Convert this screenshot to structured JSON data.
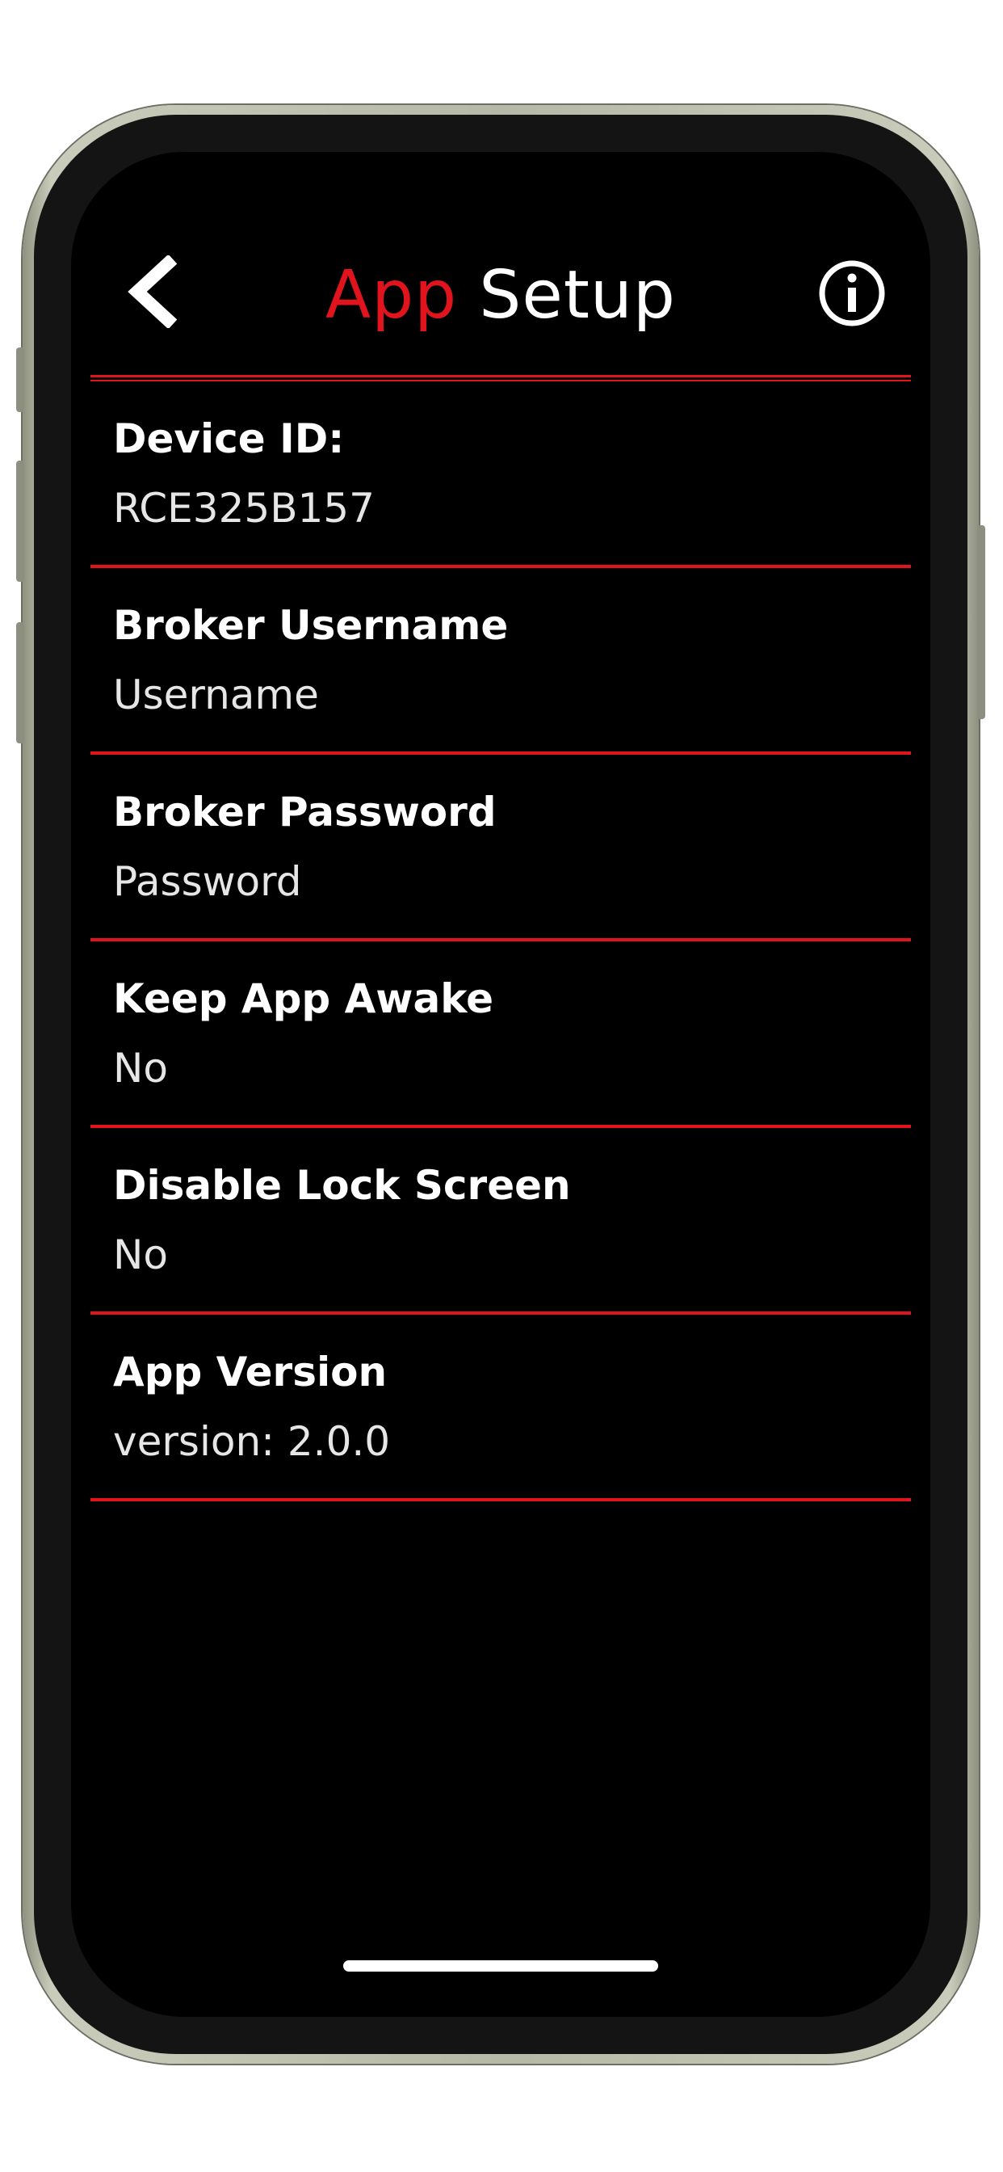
{
  "header": {
    "title_accent": "App",
    "title_rest": " Setup",
    "back_icon": "chevron-left-icon",
    "info_icon": "info-circle-icon"
  },
  "colors": {
    "accent": "#e1141e",
    "background": "#000000",
    "text": "#ffffff"
  },
  "settings": [
    {
      "label": "Device ID:",
      "value": "RCE325B157"
    },
    {
      "label": "Broker Username",
      "value": "Username"
    },
    {
      "label": "Broker Password",
      "value": "Password"
    },
    {
      "label": "Keep App Awake",
      "value": "No"
    },
    {
      "label": "Disable Lock Screen",
      "value": "No"
    },
    {
      "label": "App Version",
      "value": "version: 2.0.0"
    }
  ]
}
